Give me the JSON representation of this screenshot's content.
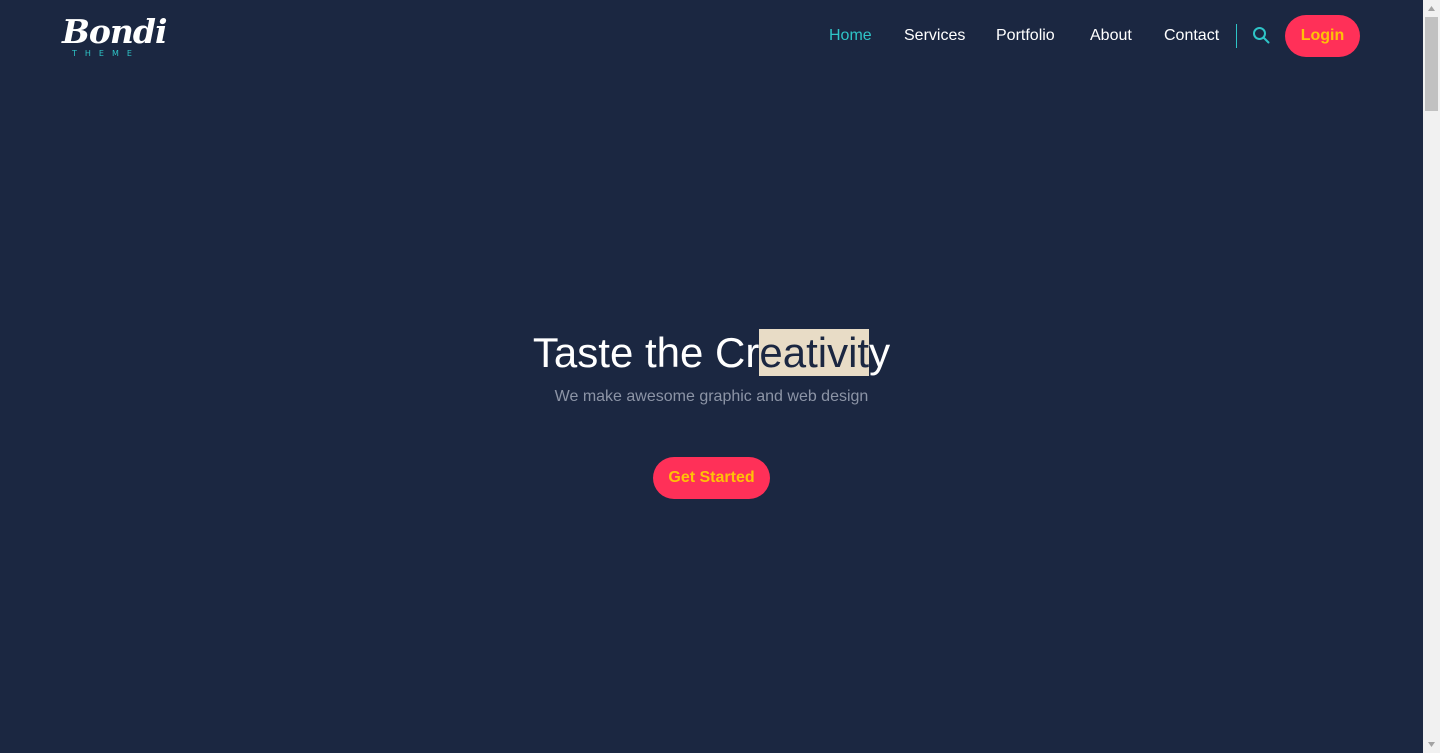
{
  "brand": {
    "name": "Bondi",
    "sub": "THEME"
  },
  "nav": {
    "items": [
      {
        "label": "Home",
        "active": true
      },
      {
        "label": "Services",
        "active": false
      },
      {
        "label": "Portfolio",
        "active": false
      },
      {
        "label": "About",
        "active": false
      },
      {
        "label": "Contact",
        "active": false
      }
    ],
    "search_icon": "search-icon",
    "login_label": "Login"
  },
  "hero": {
    "title_before": "Taste the Cr",
    "title_selected": "eativit",
    "title_after": "y",
    "subtitle": "We make awesome graphic and web design",
    "cta_label": "Get Started"
  },
  "colors": {
    "background": "#1b2741",
    "accent": "#2ec4c7",
    "button": "#ff3058",
    "button_text": "#ffc107",
    "selection": "#e8dcc6"
  }
}
